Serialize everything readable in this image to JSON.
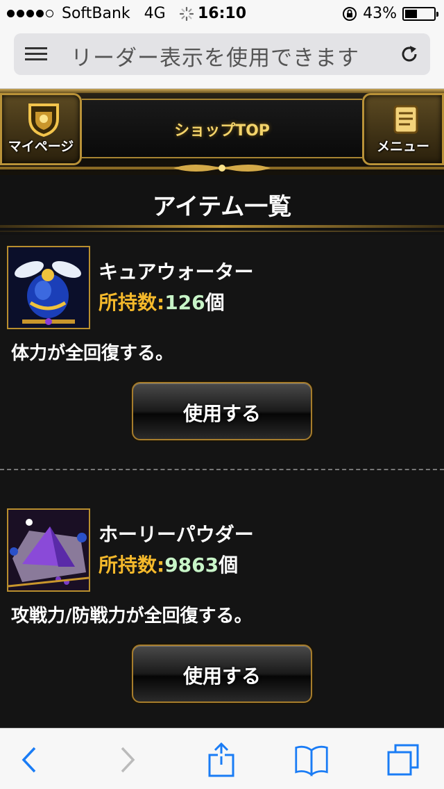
{
  "status_bar": {
    "carrier": "SoftBank",
    "network": "4G",
    "time": "16:10",
    "battery_percent_text": "43%",
    "battery_level": 0.43,
    "signal_bars_filled": 4,
    "signal_bars_total": 5
  },
  "address_bar": {
    "text": "リーダー表示を使用できます"
  },
  "game_header": {
    "left_button_label": "マイページ",
    "center_title": "ショップTOP",
    "right_button_label": "メニュー"
  },
  "page": {
    "section_title": "アイテム一覧"
  },
  "items": [
    {
      "name": "キュアウォーター",
      "count_label": "所持数:",
      "count_value": "126",
      "count_unit": "個",
      "description": "体力が全回復する。",
      "button_label": "使用する",
      "icon": "blue-potion-icon"
    },
    {
      "name": "ホーリーパウダー",
      "count_label": "所持数:",
      "count_value": "9863",
      "count_unit": "個",
      "description": "攻戦力/防戦力が全回復する。",
      "button_label": "使用する",
      "icon": "purple-powder-icon"
    }
  ],
  "toolbar": {
    "icons": [
      "back-icon",
      "forward-icon",
      "share-icon",
      "bookmarks-icon",
      "tabs-icon"
    ]
  },
  "colors": {
    "accent_gold": "#b99238",
    "count_label": "#f5b92b",
    "count_value": "#c8f5c8",
    "ios_blue": "#1a7cf5"
  }
}
